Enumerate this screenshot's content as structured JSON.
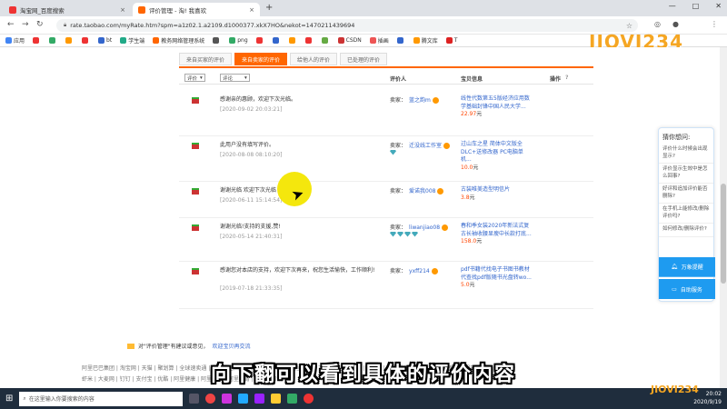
{
  "browser": {
    "tabs": [
      {
        "label": "淘宝网_百度搜索",
        "close": "×"
      },
      {
        "label": "评价管理 - 淘! 我喜欢",
        "close": "×"
      }
    ],
    "new_tab": "+",
    "window_controls": [
      "—",
      "□",
      "✕"
    ],
    "url": "rate.taobao.com/myRate.htm?spm=a1z02.1.a2109.d1000377.xkX7HO&nekot=1470211439694",
    "bookmarks": [
      "应用",
      "",
      "",
      "",
      "",
      "bt",
      "学生端",
      "教务网络管理系统",
      "",
      "png",
      "",
      "",
      "",
      "",
      "",
      "CSDN",
      "插画",
      "",
      "腾文库",
      "T"
    ]
  },
  "logo": {
    "text": "JIOVI234",
    "small": "JIOVI234"
  },
  "review_tabs": [
    {
      "label": "来自买家的评价",
      "active": false
    },
    {
      "label": "来自卖家的评价",
      "active": true
    },
    {
      "label": "给他人的评价",
      "active": false
    },
    {
      "label": "已处理的评价",
      "active": false
    }
  ],
  "columns": {
    "rating_select": "评价",
    "content_select": "评论",
    "reviewer": "评价人",
    "item_info": "宝贝信息",
    "action": "操作"
  },
  "reviews": [
    {
      "text": "感谢亲的惠顾，欢迎下次光临。",
      "date": "[2020-09-02 20:03:21]",
      "seller_label": "卖家：",
      "seller": "蓝之韵m",
      "item": "线性代数第五5版经济应用数学基础封锋中国人民大学...",
      "price": "22.97",
      "unit": "元"
    },
    {
      "text": "此用户没有填写评价。",
      "date": "[2020-08-08 08:10:20]",
      "seller_label": "卖家：",
      "seller": "迁没线工作室",
      "item": "过山车之星 简体中文版全DLC+送修改器 PC电脑单机...",
      "price": "10.0",
      "unit": "元"
    },
    {
      "text": "谢谢光临 欢迎下次光临",
      "date": "[2020-06-11 15:14:54]",
      "seller_label": "卖家：",
      "seller": "爱诺我008",
      "item": "古装唯美造型明信片",
      "price": "3.8",
      "unit": "元"
    },
    {
      "text": "谢谢光临!支持的支援,赞!",
      "date": "[2020-05-14 21:40:31]",
      "seller_label": "卖家：",
      "seller": "liwanjiao08",
      "item": "春和季女装2020年新法式复古长袖收腰显瘦中长款打底...",
      "price": "158.0",
      "unit": "元"
    },
    {
      "text": "感谢您对本店的支持，欢迎下次再来，祝您生活愉快，工作顺利!",
      "date": "[2019-07-18 21:33:35]",
      "seller_label": "卖家：",
      "seller": "yxff214",
      "item": "pdf书籍代找电子书图书教材代查找pdf版随书光盘转wo...",
      "price": "5.0",
      "unit": "元"
    }
  ],
  "management_note": {
    "prefix": "对\"评价管理\"有建议或意见，",
    "link": "欢迎宝贝再交流"
  },
  "footer": {
    "line1": "阿里巴巴集团 | 淘宝网 | 天猫 | 聚划算 | 全球速卖通 | 阿里巴巴国际交易市场 | 1688 | 阿里妈妈 | 飞猪 | 阿里云计算 | AliOS | 阿里通信 | 高德 | UC | 友盟 | 阿里安全",
    "line2": "虾米 | 大麦网 | 钉钉 | 支付宝 | 优酷 | 阿里健康 | 阿里影业 | 阿里体育 | 阿里银行"
  },
  "caption": "向下翻可以看到具体的评价内容",
  "assistant": {
    "title": "猜你想问:",
    "questions": [
      "评价什么时候会出现显示?",
      "评价显示生效中是怎么回事?",
      "好评和追加评价能否删除?",
      "在手机上能修改/删除评价吗?",
      "如何修改/删除评价?"
    ],
    "btn1": "万象提醒",
    "btn2": "自助服务"
  },
  "taskbar": {
    "search_placeholder": "在这里输入你要搜索的内容",
    "time": "20:02",
    "date": "2020/9/19"
  },
  "colors": {
    "accent": "#ff6600",
    "link": "#3366cc",
    "price": "#ff4400",
    "cursor": "#f3e600"
  }
}
